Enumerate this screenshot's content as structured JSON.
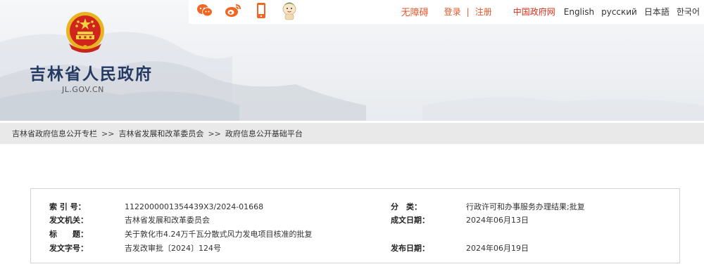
{
  "topbar": {
    "icons": [
      "wechat-icon",
      "weibo-icon",
      "mobile-icon",
      "mascot-icon"
    ],
    "accessibility": "无障碍",
    "login": "登录",
    "separator": "|",
    "register": "注册",
    "gov_portal": "中国政府网",
    "lang_english": "English",
    "lang_russian": "русский",
    "lang_japanese": "日本語",
    "lang_korean": "한국어"
  },
  "site": {
    "title": "吉林省人民政府",
    "domain": "JL.GOV.CN"
  },
  "breadcrumb": {
    "items": [
      "吉林省政府信息公开专栏",
      "吉林省发展和改革委员会",
      "政府信息公开基础平台"
    ],
    "separator": ">>"
  },
  "info": {
    "index_label": "索 引 号：",
    "index_value": "1122000001354439X3/2024-01668",
    "category_label": "分　类：",
    "category_value": "行政许可和办事服务办理结果;批复",
    "issuer_label": "发文机关：",
    "issuer_value": "吉林省发展和改革委员会",
    "date_written_label": "成文日期：",
    "date_written_value": "2024年06月13日",
    "title_label": "标　　题：",
    "title_value": "关于敦化市4.24万千瓦分散式风力发电项目核准的批复",
    "doc_no_label": "发文字号：",
    "doc_no_value": "吉发改审批〔2024〕124号",
    "publish_label": "发布日期：",
    "publish_value": "2024年06月19日"
  },
  "colors": {
    "accent_orange": "#e3572b",
    "gov_red": "#d6301c",
    "title_navy": "#243a63",
    "breadcrumb_bg": "#e9e9e9"
  }
}
